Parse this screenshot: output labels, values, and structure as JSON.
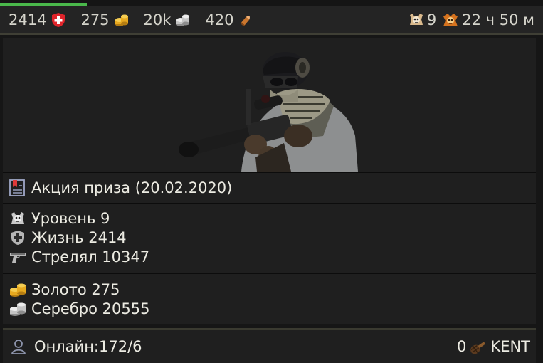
{
  "progress": {
    "fraction": 0.16
  },
  "topbar": {
    "health_value": "2414",
    "gold_value": "275",
    "silver_value": "20k",
    "ammo_value": "420",
    "level_value": "9",
    "timer_value": "22 ч 50 м",
    "icons": {
      "health": "red-cross-shield-icon",
      "gold": "gold-coins-icon",
      "silver": "silver-coins-icon",
      "ammo": "bullet-icon",
      "level": "skull-emblem-icon",
      "timer": "orange-skull-emblem-icon"
    }
  },
  "hero": {
    "image": "sniper-soldier-image"
  },
  "promo": {
    "label": "Акция приза (20.02.2020)",
    "icon": "bookmark-icon"
  },
  "stats": [
    {
      "label": "Уровень 9",
      "icon": "skull-emblem-icon"
    },
    {
      "label": "Жизнь 2414",
      "icon": "shield-cross-icon"
    },
    {
      "label": "Стрелял 10347",
      "icon": "pistol-icon"
    }
  ],
  "money": [
    {
      "label": "Золото 275",
      "icon": "gold-coins-icon"
    },
    {
      "label": "Серебро 20555",
      "icon": "silver-coins-icon"
    }
  ],
  "footer": {
    "online": "Онлайн:172/6",
    "grenade_count": "0",
    "username": "KENT",
    "icons": {
      "user": "user-icon",
      "grenade": "grenade-icon"
    }
  },
  "colors": {
    "background": "#161616",
    "panel": "#1f1f1f",
    "text": "#ecebe2",
    "progress": "#4ab84b",
    "health": "#e0242b",
    "gold": "#e7a91f",
    "silver": "#d8d8d8"
  }
}
